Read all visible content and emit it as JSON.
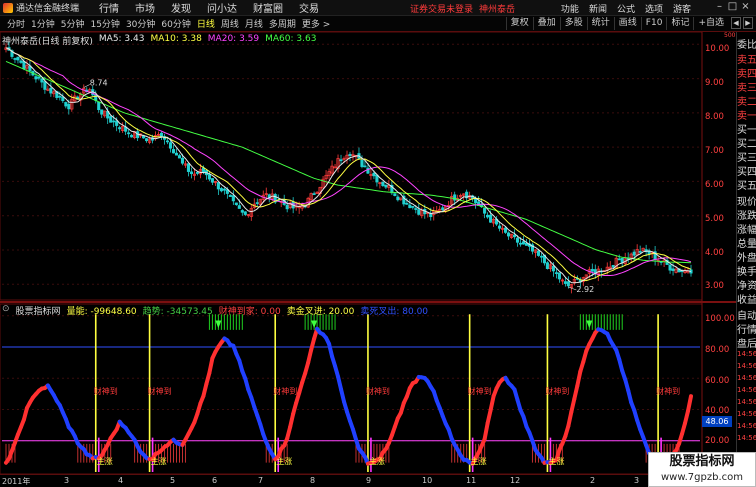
{
  "titlebar": {
    "app_title": "通达信金融终端",
    "menu": [
      "行情",
      "市场",
      "发现",
      "问小达",
      "财富圈",
      "交易"
    ],
    "login_warning": "证券交易未登录",
    "stock_name_top": "神州泰岳",
    "sys_menu": [
      "功能",
      "新闻",
      "公式",
      "选项",
      "游客"
    ],
    "window_controls": [
      "–",
      "□",
      "×"
    ]
  },
  "toolbar": {
    "periods": [
      "分时",
      "1分钟",
      "5分钟",
      "15分钟",
      "30分钟",
      "60分钟",
      "日线",
      "周线",
      "月线",
      "多周期",
      "更多 >"
    ],
    "active_period": "日线",
    "tools": [
      "复权",
      "叠加",
      "多股",
      "统计",
      "画线",
      "F10",
      "标记",
      "+自选"
    ],
    "arrows": [
      "◀",
      "▶"
    ]
  },
  "main_chart": {
    "stock_label": "神州泰岳(日线 前复权)",
    "ma5": "MA5: 3.43",
    "ma10": "MA10: 3.38",
    "ma20": "MA20: 3.59",
    "ma60": "MA60: 3.63",
    "high_label": "8.74",
    "low_label": "2.92",
    "y_ticks": [
      "10.00",
      "9.00",
      "8.00",
      "7.00",
      "6.00",
      "5.00",
      "4.00",
      "3.00"
    ],
    "axis_top_mark": "500"
  },
  "indicator": {
    "title": "股票指标网",
    "values": [
      {
        "text": "量能: -99648.60",
        "color": "#ffff44"
      },
      {
        "text": "趋势: -34573.45",
        "color": "#44cc44"
      },
      {
        "text": "财神到家: 0.00",
        "color": "#ff4040"
      },
      {
        "text": "卖金叉进: 20.00",
        "color": "#ffff44"
      },
      {
        "text": "卖死叉出: 80.00",
        "color": "#3050ff"
      }
    ],
    "y_ticks": [
      "100.00",
      "80.00",
      "60.00",
      "40.00",
      "20.00"
    ],
    "current_value": "48.06",
    "signal_label": "财神到",
    "buy_label": "主涨"
  },
  "right_panel": {
    "items": [
      "委比",
      "卖五",
      "卖四",
      "卖三",
      "卖二",
      "卖一",
      "买一",
      "买二",
      "买三",
      "买四",
      "买五",
      "现价",
      "涨跌",
      "涨幅",
      "总量",
      "外盘",
      "换手",
      "净资",
      "收益",
      "自动",
      "行情",
      "盘后",
      "14:56",
      "14:56",
      "14:56",
      "14:56",
      "14:56",
      "14:56",
      "14:56",
      "14:56"
    ]
  },
  "date_axis": {
    "labels": [
      "2011年",
      "3",
      "4",
      "5",
      "6",
      "7",
      "8",
      "9",
      "10",
      "11",
      "12",
      "2",
      "3"
    ]
  },
  "watermark": {
    "title": "股票指标网",
    "url": "www.7gpzb.com"
  },
  "chart_data": [
    {
      "type": "candlestick",
      "title": "神州泰岳(日线 前复权)",
      "ylim": [
        2.6,
        10.3
      ],
      "y_ticks": [
        10,
        9,
        8,
        7,
        6,
        5,
        4,
        3
      ],
      "annotations": [
        {
          "text": "8.74",
          "kind": "high"
        },
        {
          "text": "2.92",
          "kind": "low"
        }
      ],
      "series": [
        {
          "name": "MA5",
          "values": [
            3.43
          ],
          "color": "#e8e8e8"
        },
        {
          "name": "MA10",
          "values": [
            3.38
          ],
          "color": "#ffff44"
        },
        {
          "name": "MA20",
          "values": [
            3.59
          ],
          "color": "#ff44ff"
        },
        {
          "name": "MA60",
          "values": [
            3.63
          ],
          "color": "#44ff44"
        }
      ],
      "close_trend": [
        9.9,
        9.6,
        9.3,
        9.0,
        8.7,
        8.5,
        8.2,
        8.5,
        8.74,
        8.1,
        7.8,
        7.6,
        7.4,
        7.3,
        7.2,
        7.4,
        7.0,
        6.5,
        6.2,
        6.3,
        6.0,
        5.7,
        5.3,
        5.0,
        5.4,
        5.6,
        5.5,
        5.3,
        5.2,
        5.4,
        5.8,
        6.2,
        6.6,
        6.9,
        6.6,
        6.3,
        6.0,
        5.8,
        5.5,
        5.3,
        5.1,
        5.0,
        5.2,
        5.5,
        5.7,
        5.5,
        5.1,
        4.8,
        4.5,
        4.3,
        4.1,
        3.9,
        3.6,
        3.3,
        2.92,
        3.1,
        3.3,
        3.4,
        3.5,
        3.7,
        3.8,
        4.0,
        3.9,
        3.7,
        3.5,
        3.4,
        3.43
      ],
      "ma60_trend": [
        9.5,
        9.2,
        8.9,
        8.6,
        8.3,
        8.0,
        7.8,
        7.6,
        7.4,
        7.2,
        7.0,
        6.7,
        6.4,
        6.1,
        5.9,
        5.8,
        5.7,
        5.65,
        5.6,
        5.5,
        5.3,
        5.1,
        4.9,
        4.6,
        4.3,
        4.0,
        3.8,
        3.7,
        3.65,
        3.63
      ]
    },
    {
      "type": "line",
      "title": "股票指标网",
      "ylim": [
        0,
        105
      ],
      "y_ticks": [
        100,
        80,
        60,
        40,
        20
      ],
      "series": [
        {
          "name": "量能",
          "values": [
            -99648.6
          ],
          "color": "#ffff44"
        },
        {
          "name": "趋势",
          "values": [
            -34573.45
          ],
          "color": "#44cc44"
        },
        {
          "name": "财神到家",
          "values": [
            0.0
          ],
          "color": "#ff4040"
        },
        {
          "name": "卖金叉进",
          "values": [
            20.0
          ],
          "color": "#ffff44"
        },
        {
          "name": "卖死叉出",
          "values": [
            80.0
          ],
          "color": "#3050ff"
        }
      ],
      "oscillator": [
        5,
        20,
        40,
        52,
        55,
        45,
        30,
        18,
        10,
        8,
        20,
        32,
        25,
        12,
        8,
        15,
        20,
        18,
        30,
        48,
        75,
        85,
        80,
        60,
        40,
        20,
        8,
        20,
        45,
        68,
        92,
        85,
        60,
        35,
        15,
        5,
        8,
        20,
        38,
        55,
        62,
        55,
        38,
        20,
        8,
        5,
        18,
        50,
        62,
        52,
        32,
        15,
        5,
        8,
        25,
        55,
        80,
        92,
        88,
        75,
        50,
        30,
        12,
        5,
        8,
        20,
        48
      ]
    }
  ]
}
